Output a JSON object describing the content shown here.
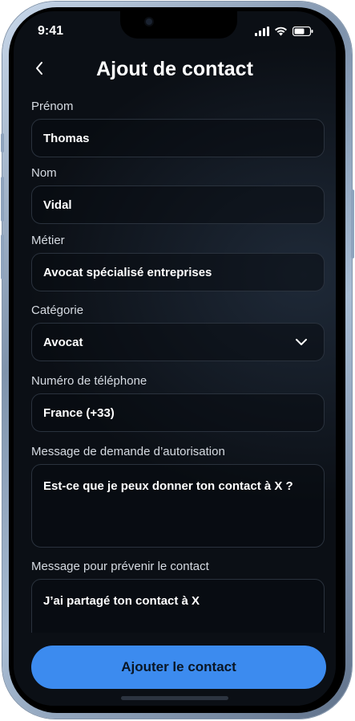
{
  "status_bar": {
    "time": "9:41"
  },
  "header": {
    "back_icon": "chevron-left-icon",
    "title": "Ajout de contact"
  },
  "form": {
    "first_name": {
      "label": "Prénom",
      "value": "Thomas"
    },
    "last_name": {
      "label": "Nom",
      "value": "Vidal"
    },
    "job": {
      "label": "Métier",
      "value": "Avocat spécialisé entreprises"
    },
    "category": {
      "label": "Catégorie",
      "value": "Avocat",
      "icon": "chevron-down-icon"
    },
    "phone": {
      "label": "Numéro de téléphone",
      "value": "France (+33)"
    },
    "auth_message": {
      "label": "Message de demande d’autorisation",
      "value": "Est-ce que je peux donner ton contact à X ?"
    },
    "notify_message": {
      "label": "Message pour prévenir le contact",
      "value": "J’ai partagé ton contact à X"
    }
  },
  "actions": {
    "submit_label": "Ajouter le contact"
  },
  "colors": {
    "accent": "#3c8bef",
    "background": "#0b0f15",
    "field_border": "#2a323d"
  }
}
